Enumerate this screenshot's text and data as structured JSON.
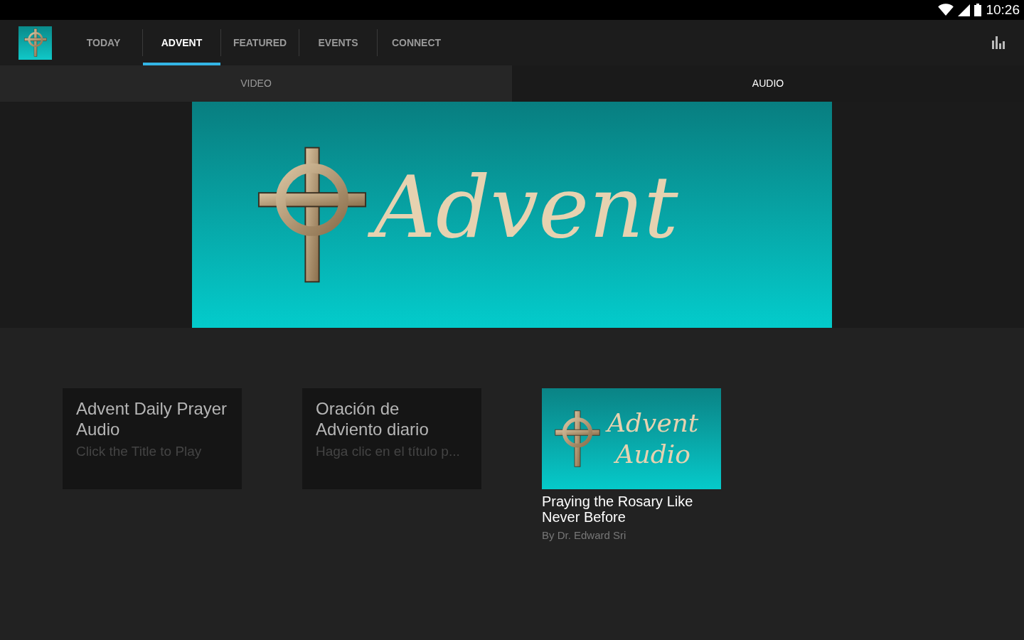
{
  "status_bar": {
    "time": "10:26"
  },
  "tabs": [
    {
      "label": "TODAY",
      "selected": false
    },
    {
      "label": "ADVENT",
      "selected": true
    },
    {
      "label": "FEATURED",
      "selected": false
    },
    {
      "label": "EVENTS",
      "selected": false
    },
    {
      "label": "CONNECT",
      "selected": false
    }
  ],
  "sub_tabs": [
    {
      "label": "VIDEO",
      "selected": false
    },
    {
      "label": "AUDIO",
      "selected": true
    }
  ],
  "banner": {
    "title": "Advent"
  },
  "cards": [
    {
      "kind": "text",
      "title": "Advent Daily Prayer Audio",
      "subtitle": "Click the Title to Play"
    },
    {
      "kind": "text",
      "title": "Oración de Adviento diario",
      "subtitle": "Haga clic en el título p..."
    },
    {
      "kind": "image",
      "art_lines": [
        "Advent",
        "Audio"
      ],
      "title": "Praying the Rosary Like Never Before",
      "subtitle": "By Dr. Edward Sri"
    }
  ]
}
